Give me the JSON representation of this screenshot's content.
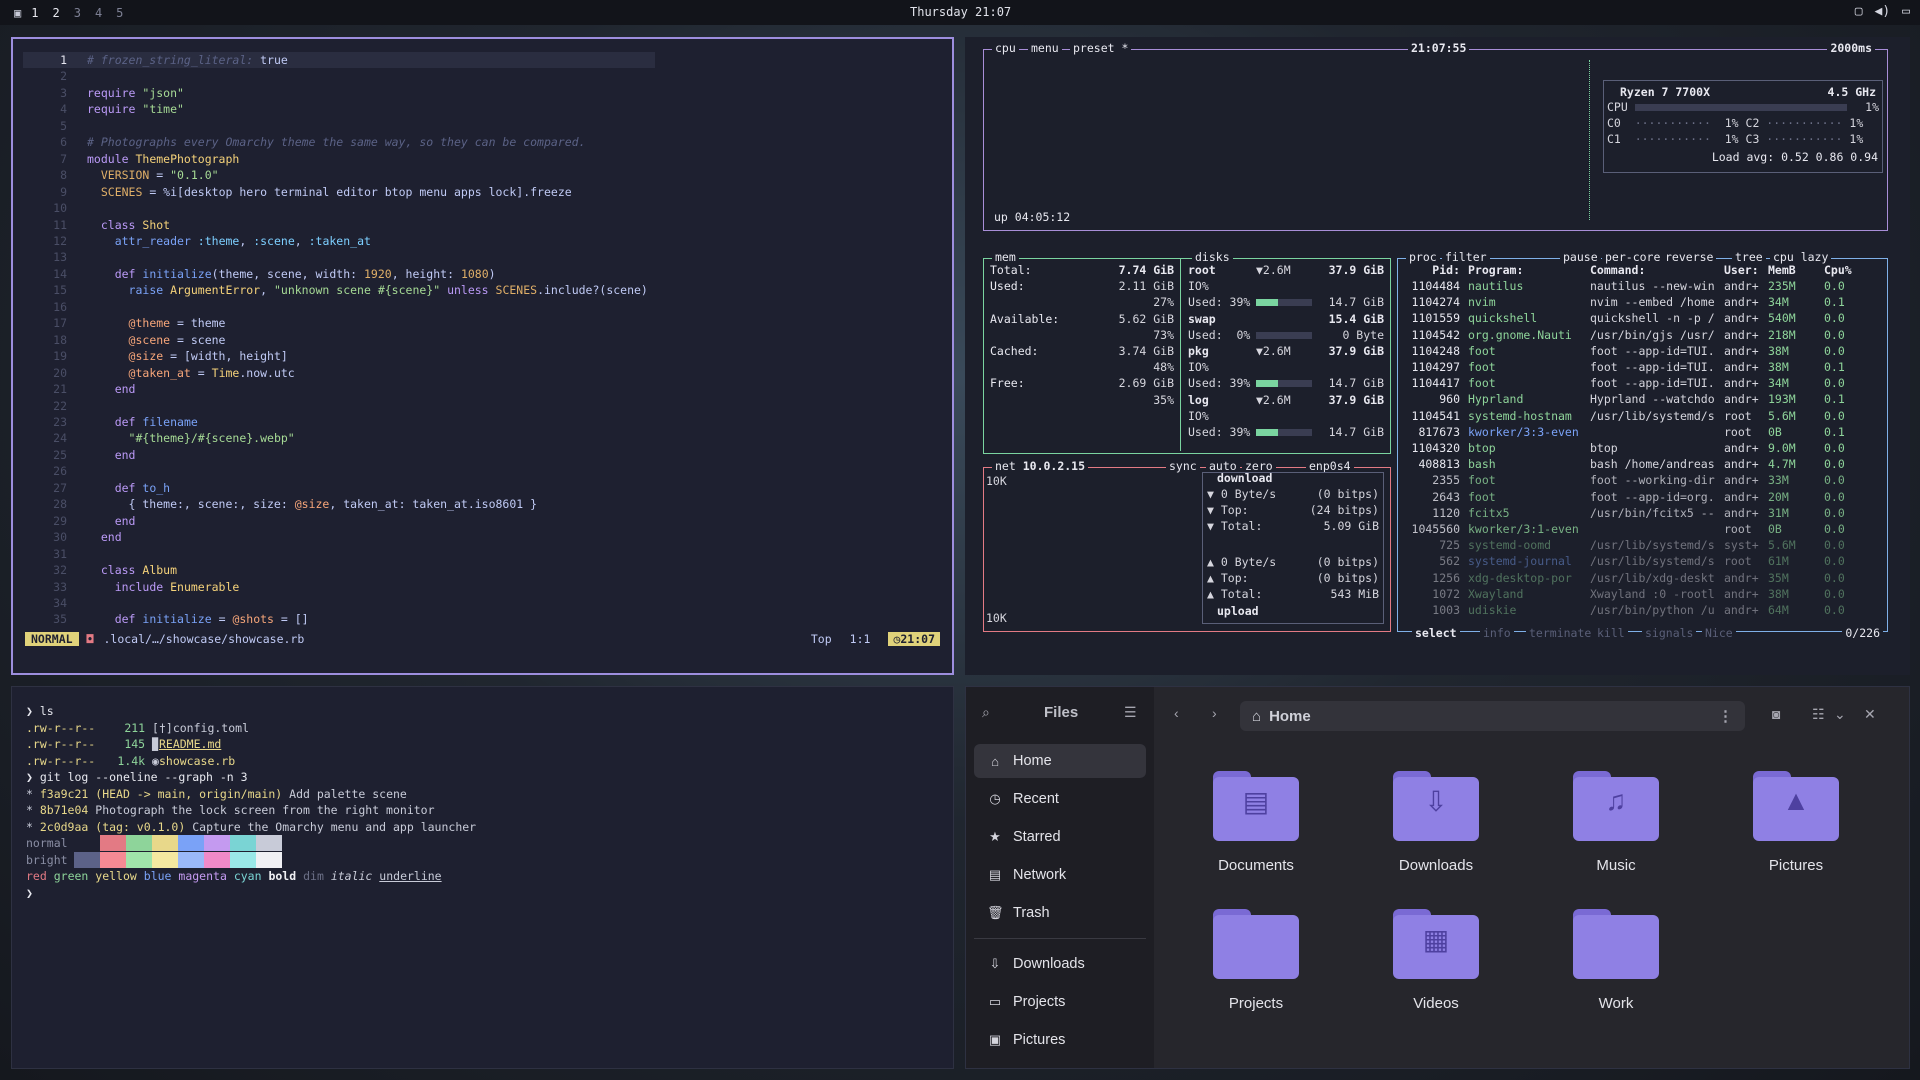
{
  "topbar": {
    "workspaces": [
      "1",
      "2",
      "3",
      "4",
      "5"
    ],
    "active_workspace": "1",
    "clock": "Thursday 21:07"
  },
  "editor": {
    "lines": [
      {
        "n": "1",
        "t": [
          [
            "c-com",
            "# frozen_string_literal: "
          ],
          [
            "c-plain",
            "true"
          ]
        ]
      },
      {
        "n": "2",
        "t": []
      },
      {
        "n": "3",
        "t": [
          [
            "c-kw",
            "require "
          ],
          [
            "c-str",
            "\"json\""
          ]
        ]
      },
      {
        "n": "4",
        "t": [
          [
            "c-kw",
            "require "
          ],
          [
            "c-str",
            "\"time\""
          ]
        ]
      },
      {
        "n": "5",
        "t": []
      },
      {
        "n": "6",
        "t": [
          [
            "c-com",
            "# Photographs every Omarchy theme the same way, so they can be compared."
          ]
        ]
      },
      {
        "n": "7",
        "t": [
          [
            "c-kw",
            "module "
          ],
          [
            "c-cls",
            "ThemePhotograph"
          ]
        ]
      },
      {
        "n": "8",
        "t": [
          [
            "c-plain",
            "  "
          ],
          [
            "c-const",
            "VERSION"
          ],
          [
            "c-plain",
            " = "
          ],
          [
            "c-str",
            "\"0.1.0\""
          ]
        ]
      },
      {
        "n": "9",
        "t": [
          [
            "c-plain",
            "  "
          ],
          [
            "c-const",
            "SCENES"
          ],
          [
            "c-plain",
            " = %i[desktop hero terminal editor btop menu apps lock].freeze"
          ]
        ]
      },
      {
        "n": "10",
        "t": []
      },
      {
        "n": "11",
        "t": [
          [
            "c-plain",
            "  "
          ],
          [
            "c-kw",
            "class "
          ],
          [
            "c-cls",
            "Shot"
          ]
        ]
      },
      {
        "n": "12",
        "t": [
          [
            "c-plain",
            "    "
          ],
          [
            "c-fn",
            "attr_reader "
          ],
          [
            "c-sym",
            ":theme"
          ],
          [
            "c-plain",
            ", "
          ],
          [
            "c-sym",
            ":scene"
          ],
          [
            "c-plain",
            ", "
          ],
          [
            "c-sym",
            ":taken_at"
          ]
        ]
      },
      {
        "n": "13",
        "t": []
      },
      {
        "n": "14",
        "t": [
          [
            "c-plain",
            "    "
          ],
          [
            "c-kw",
            "def "
          ],
          [
            "c-fn",
            "initialize"
          ],
          [
            "c-plain",
            "(theme, scene, width: "
          ],
          [
            "c-const",
            "1920"
          ],
          [
            "c-plain",
            ", height: "
          ],
          [
            "c-const",
            "1080"
          ],
          [
            "c-plain",
            ")"
          ]
        ]
      },
      {
        "n": "15",
        "t": [
          [
            "c-plain",
            "      "
          ],
          [
            "c-fn",
            "raise "
          ],
          [
            "c-cls",
            "ArgumentError"
          ],
          [
            "c-plain",
            ", "
          ],
          [
            "c-str",
            "\"unknown scene #{scene}\""
          ],
          [
            "c-kw",
            " unless "
          ],
          [
            "c-const",
            "SCENES"
          ],
          [
            "c-plain",
            ".include?(scene)"
          ]
        ]
      },
      {
        "n": "16",
        "t": []
      },
      {
        "n": "17",
        "t": [
          [
            "c-plain",
            "      "
          ],
          [
            "c-ivar",
            "@theme"
          ],
          [
            "c-plain",
            " = theme"
          ]
        ]
      },
      {
        "n": "18",
        "t": [
          [
            "c-plain",
            "      "
          ],
          [
            "c-ivar",
            "@scene"
          ],
          [
            "c-plain",
            " = scene"
          ]
        ]
      },
      {
        "n": "19",
        "t": [
          [
            "c-plain",
            "      "
          ],
          [
            "c-ivar",
            "@size"
          ],
          [
            "c-plain",
            " = [width, height]"
          ]
        ]
      },
      {
        "n": "20",
        "t": [
          [
            "c-plain",
            "      "
          ],
          [
            "c-ivar",
            "@taken_at"
          ],
          [
            "c-plain",
            " = "
          ],
          [
            "c-cls",
            "Time"
          ],
          [
            "c-plain",
            ".now.utc"
          ]
        ]
      },
      {
        "n": "21",
        "t": [
          [
            "c-plain",
            "    "
          ],
          [
            "c-kw",
            "end"
          ]
        ]
      },
      {
        "n": "22",
        "t": []
      },
      {
        "n": "23",
        "t": [
          [
            "c-plain",
            "    "
          ],
          [
            "c-kw",
            "def "
          ],
          [
            "c-fn",
            "filename"
          ]
        ]
      },
      {
        "n": "24",
        "t": [
          [
            "c-plain",
            "      "
          ],
          [
            "c-str",
            "\"#{theme}/#{scene}.webp\""
          ]
        ]
      },
      {
        "n": "25",
        "t": [
          [
            "c-plain",
            "    "
          ],
          [
            "c-kw",
            "end"
          ]
        ]
      },
      {
        "n": "26",
        "t": []
      },
      {
        "n": "27",
        "t": [
          [
            "c-plain",
            "    "
          ],
          [
            "c-kw",
            "def "
          ],
          [
            "c-fn",
            "to_h"
          ]
        ]
      },
      {
        "n": "28",
        "t": [
          [
            "c-plain",
            "      { theme:, scene:, size: "
          ],
          [
            "c-ivar",
            "@size"
          ],
          [
            "c-plain",
            ", taken_at: taken_at.iso8601 }"
          ]
        ]
      },
      {
        "n": "29",
        "t": [
          [
            "c-plain",
            "    "
          ],
          [
            "c-kw",
            "end"
          ]
        ]
      },
      {
        "n": "30",
        "t": [
          [
            "c-plain",
            "  "
          ],
          [
            "c-kw",
            "end"
          ]
        ]
      },
      {
        "n": "31",
        "t": []
      },
      {
        "n": "32",
        "t": [
          [
            "c-plain",
            "  "
          ],
          [
            "c-kw",
            "class "
          ],
          [
            "c-cls",
            "Album"
          ]
        ]
      },
      {
        "n": "33",
        "t": [
          [
            "c-plain",
            "    "
          ],
          [
            "c-kw",
            "include "
          ],
          [
            "c-cls",
            "Enumerable"
          ]
        ]
      },
      {
        "n": "34",
        "t": []
      },
      {
        "n": "35",
        "t": [
          [
            "c-plain",
            "    "
          ],
          [
            "c-kw",
            "def "
          ],
          [
            "c-fn",
            "initialize"
          ],
          [
            "c-plain",
            " = "
          ],
          [
            "c-ivar",
            "@shots"
          ],
          [
            "c-plain",
            " = []"
          ]
        ]
      }
    ],
    "mode": "NORMAL",
    "path": ".local/…/showcase/showcase.rb",
    "position": "Top",
    "cursor": "1:1",
    "time": "21:07"
  },
  "btop": {
    "cpu_title": "cpu",
    "menu_title": "menu",
    "preset_title": "preset *",
    "time": "21:07:55",
    "interval": "2000ms",
    "cpu_model": "Ryzen 7 7700X",
    "cpu_freq": "4.5 GHz",
    "cpu_rows": [
      {
        "label": "CPU",
        "pct": "1%"
      },
      {
        "label": "C0",
        "pct": "1%",
        "label2": "C2",
        "pct2": "1%"
      },
      {
        "label": "C1",
        "pct": "1%",
        "label2": "C3",
        "pct2": "1%"
      }
    ],
    "load_avg": "Load avg: 0.52 0.86 0.94",
    "uptime": "up 04:05:12",
    "mem_title": "mem",
    "disks_title": "disks",
    "mem_rows": [
      {
        "k": "Total:",
        "v": "7.74 GiB"
      },
      {
        "k": "Used:",
        "v": "2.11 GiB"
      },
      {
        "k": "",
        "v": "27%"
      },
      {
        "k": "Available:",
        "v": "5.62 GiB"
      },
      {
        "k": "",
        "v": "73%"
      },
      {
        "k": "Cached:",
        "v": "3.74 GiB"
      },
      {
        "k": "",
        "v": "48%"
      },
      {
        "k": "Free:",
        "v": "2.69 GiB"
      },
      {
        "k": "",
        "v": "35%"
      }
    ],
    "disk_rows": [
      {
        "k": "root",
        "m": "▼2.6M",
        "v": "37.9 GiB"
      },
      {
        "k": "IO%",
        "m": "",
        "v": ""
      },
      {
        "k": "Used: 39%",
        "m": "bar",
        "v": "14.7 GiB"
      },
      {
        "k": "swap",
        "m": "",
        "v": "15.4 GiB"
      },
      {
        "k": "Used:  0%",
        "m": "bar0",
        "v": "0 Byte"
      },
      {
        "k": "pkg",
        "m": "▼2.6M",
        "v": "37.9 GiB"
      },
      {
        "k": "IO%",
        "m": "",
        "v": ""
      },
      {
        "k": "Used: 39%",
        "m": "bar",
        "v": "14.7 GiB"
      },
      {
        "k": "log",
        "m": "▼2.6M",
        "v": "37.9 GiB"
      },
      {
        "k": "IO%",
        "m": "",
        "v": ""
      },
      {
        "k": "Used: 39%",
        "m": "bar",
        "v": "14.7 GiB"
      }
    ],
    "net_title": "net",
    "net_ip": "10.0.2.15",
    "net_sync": "sync",
    "net_auto": "auto",
    "net_zero": "zero",
    "net_iface": "enp0s4",
    "net_scale_top": "10K",
    "net_scale_bottom": "10K",
    "download_label": "download",
    "upload_label": "upload",
    "net_down": [
      {
        "k": "▼ 0 Byte/s",
        "v": "(0 bitps)"
      },
      {
        "k": "▼ Top:",
        "v": "(24 bitps)"
      },
      {
        "k": "▼ Total:",
        "v": "5.09 GiB"
      }
    ],
    "net_up": [
      {
        "k": "▲ 0 Byte/s",
        "v": "(0 bitps)"
      },
      {
        "k": "▲ Top:",
        "v": "(0 bitps)"
      },
      {
        "k": "▲ Total:",
        "v": "543 MiB"
      }
    ],
    "proc_header": [
      "proc",
      "filter",
      "pause",
      "per-core",
      "reverse",
      "tree",
      "cpu lazy"
    ],
    "proc_cols": {
      "pid": "Pid:",
      "program": "Program:",
      "command": "Command:",
      "user": "User:",
      "mem": "MemB",
      "cpu": "Cpu%"
    },
    "procs": [
      [
        "1104484",
        "nautilus",
        "nautilus --new-win",
        "andr+",
        "235M",
        "0.0"
      ],
      [
        "1104274",
        "nvim",
        "nvim --embed /home",
        "andr+",
        "34M",
        "0.1"
      ],
      [
        "1101559",
        "quickshell",
        "quickshell -n -p /",
        "andr+",
        "540M",
        "0.0"
      ],
      [
        "1104542",
        "org.gnome.Nauti",
        "/usr/bin/gjs /usr/",
        "andr+",
        "218M",
        "0.0"
      ],
      [
        "1104248",
        "foot",
        "foot --app-id=TUI.",
        "andr+",
        "38M",
        "0.0"
      ],
      [
        "1104297",
        "foot",
        "foot --app-id=TUI.",
        "andr+",
        "38M",
        "0.1"
      ],
      [
        "1104417",
        "foot",
        "foot --app-id=TUI.",
        "andr+",
        "34M",
        "0.0"
      ],
      [
        "960",
        "Hyprland",
        "Hyprland --watchdo",
        "andr+",
        "193M",
        "0.1"
      ],
      [
        "1104541",
        "systemd-hostnam",
        "/usr/lib/systemd/s",
        "root",
        "5.6M",
        "0.0"
      ],
      [
        "817673",
        "kworker/3:3-even",
        "",
        "root",
        "0B",
        "0.1"
      ],
      [
        "1104320",
        "btop",
        "btop",
        "andr+",
        "9.0M",
        "0.0"
      ],
      [
        "408813",
        "bash",
        "bash /home/andreas",
        "andr+",
        "4.7M",
        "0.0"
      ],
      [
        "2355",
        "foot",
        "foot --working-dir",
        "andr+",
        "33M",
        "0.0"
      ],
      [
        "2643",
        "foot",
        "foot --app-id=org.",
        "andr+",
        "20M",
        "0.0"
      ],
      [
        "1120",
        "fcitx5",
        "/usr/bin/fcitx5 --",
        "andr+",
        "31M",
        "0.0"
      ],
      [
        "1045560",
        "kworker/3:1-even",
        "",
        "root",
        "0B",
        "0.0"
      ],
      [
        "725",
        "systemd-oomd",
        "/usr/lib/systemd/s",
        "syst+",
        "5.6M",
        "0.0"
      ],
      [
        "562",
        "systemd-journal",
        "/usr/lib/systemd/s",
        "root",
        "61M",
        "0.0"
      ],
      [
        "1256",
        "xdg-desktop-por",
        "/usr/lib/xdg-deskt",
        "andr+",
        "35M",
        "0.0"
      ],
      [
        "1072",
        "Xwayland",
        "Xwayland :0 -rootl",
        "andr+",
        "38M",
        "0.0"
      ],
      [
        "1003",
        "udiskie",
        "/usr/bin/python /u",
        "andr+",
        "64M",
        "0.0"
      ]
    ],
    "proc_footer": [
      "select",
      "info",
      "terminate",
      "kill",
      "signals",
      "Nice"
    ],
    "proc_count": "0/226"
  },
  "terminal": {
    "prompt": "❯",
    "cmd1": "ls",
    "files": [
      {
        "perm": ".rw-r--r--",
        "size": "211",
        "icon": "[†]",
        "name": "config.toml"
      },
      {
        "perm": ".rw-r--r--",
        "size": "145",
        "icon": "▉",
        "name": "README.md"
      },
      {
        "perm": ".rw-r--r--",
        "size": "1.4k",
        "icon": "◉",
        "name": "showcase.rb"
      }
    ],
    "cmd2": "git log --oneline --graph -n 3",
    "commits": [
      {
        "hash": "f3a9c21",
        "ref": "(HEAD -> main, origin/main)",
        "msg": "Add palette scene"
      },
      {
        "hash": "8b71e04",
        "ref": "",
        "msg": "Photograph the lock screen from the right monitor"
      },
      {
        "hash": "2c0d9aa",
        "ref": "(tag: v0.1.0)",
        "msg": "Capture the Omarchy menu and app launcher"
      }
    ],
    "normal_label": "normal",
    "bright_label": "bright",
    "normal_colors": [
      "#1e2030",
      "#e37a84",
      "#8ed49a",
      "#e8d88a",
      "#7aa2f7",
      "#c49af0",
      "#7ad4d4",
      "#c8cbd8"
    ],
    "bright_colors": [
      "#5c6288",
      "#f58a94",
      "#a0e4aa",
      "#f4e8a0",
      "#9ab8f8",
      "#f08ac8",
      "#9ae8e8",
      "#f0f0f4"
    ],
    "styles": [
      "red",
      "green",
      "yellow",
      "blue",
      "magenta",
      "cyan",
      "bold",
      "dim",
      "italic",
      "underline"
    ]
  },
  "files": {
    "title": "Files",
    "location": "Home",
    "sidebar": [
      {
        "icon": "home-icon",
        "glyph": "⌂",
        "label": "Home",
        "active": true
      },
      {
        "icon": "clock-icon",
        "glyph": "◷",
        "label": "Recent"
      },
      {
        "icon": "star-icon",
        "glyph": "★",
        "label": "Starred"
      },
      {
        "icon": "network-icon",
        "glyph": "▤",
        "label": "Network"
      },
      {
        "icon": "trash-icon",
        "glyph": "🗑",
        "label": "Trash"
      },
      {
        "icon": "download-icon",
        "glyph": "⇩",
        "label": "Downloads"
      },
      {
        "icon": "folder-icon",
        "glyph": "▭",
        "label": "Projects"
      },
      {
        "icon": "image-icon",
        "glyph": "▣",
        "label": "Pictures"
      }
    ],
    "folders": [
      {
        "label": "Documents",
        "glyph": "▤"
      },
      {
        "label": "Downloads",
        "glyph": "⇩"
      },
      {
        "label": "Music",
        "glyph": "♫"
      },
      {
        "label": "Pictures",
        "glyph": "▲"
      },
      {
        "label": "Projects",
        "glyph": ""
      },
      {
        "label": "Videos",
        "glyph": "▦"
      },
      {
        "label": "Work",
        "glyph": ""
      }
    ]
  }
}
